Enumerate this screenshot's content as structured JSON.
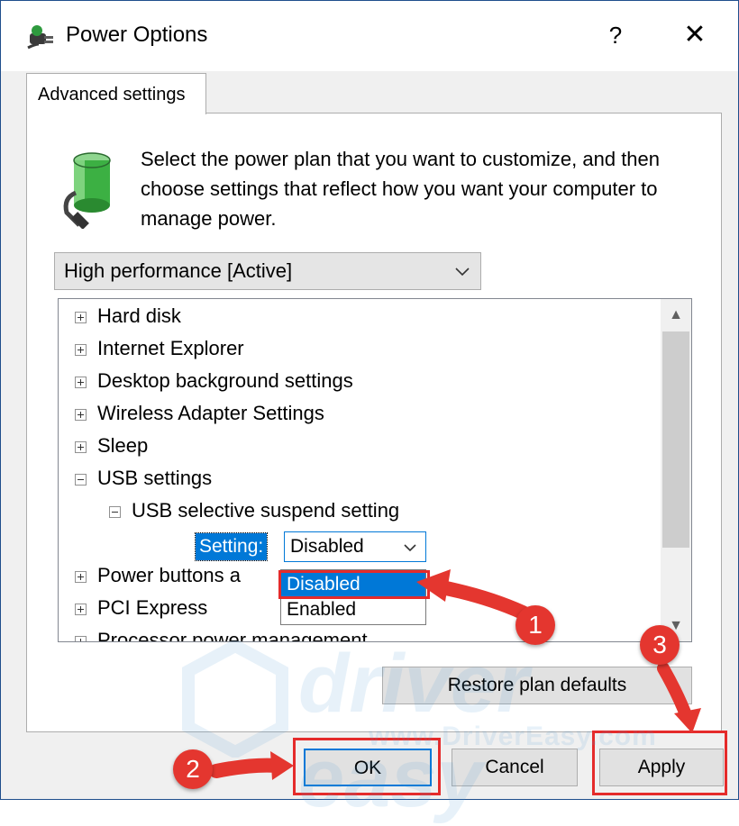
{
  "window": {
    "title": "Power Options",
    "help_label": "?",
    "close_label": "✕"
  },
  "tab": {
    "label": "Advanced settings"
  },
  "intro_text": "Select the power plan that you want to customize, and then choose settings that reflect how you want your computer to manage power.",
  "plan_select": {
    "value": "High performance [Active]"
  },
  "tree": {
    "items": [
      {
        "label": "Hard disk",
        "state": "collapsed"
      },
      {
        "label": "Internet Explorer",
        "state": "collapsed"
      },
      {
        "label": "Desktop background settings",
        "state": "collapsed"
      },
      {
        "label": "Wireless Adapter Settings",
        "state": "collapsed"
      },
      {
        "label": "Sleep",
        "state": "collapsed"
      },
      {
        "label": "USB settings",
        "state": "expanded"
      },
      {
        "label": "USB selective suspend setting",
        "state": "expanded"
      },
      {
        "label": "Power buttons a",
        "state": "collapsed"
      },
      {
        "label": "PCI Express",
        "state": "collapsed"
      },
      {
        "label": "Processor power management",
        "state": "collapsed"
      }
    ],
    "setting_label": "Setting:",
    "setting_value": "Disabled",
    "dropdown_options": [
      "Disabled",
      "Enabled"
    ]
  },
  "buttons": {
    "restore": "Restore plan defaults",
    "ok": "OK",
    "cancel": "Cancel",
    "apply": "Apply"
  },
  "annotations": {
    "badges": [
      "1",
      "2",
      "3"
    ],
    "color": "#e4362f"
  },
  "watermark": {
    "name": "driver easy",
    "site": "www.DriverEasy.com"
  },
  "colors": {
    "accent": "#0078d7",
    "highlight_box": "#e52b2b"
  }
}
